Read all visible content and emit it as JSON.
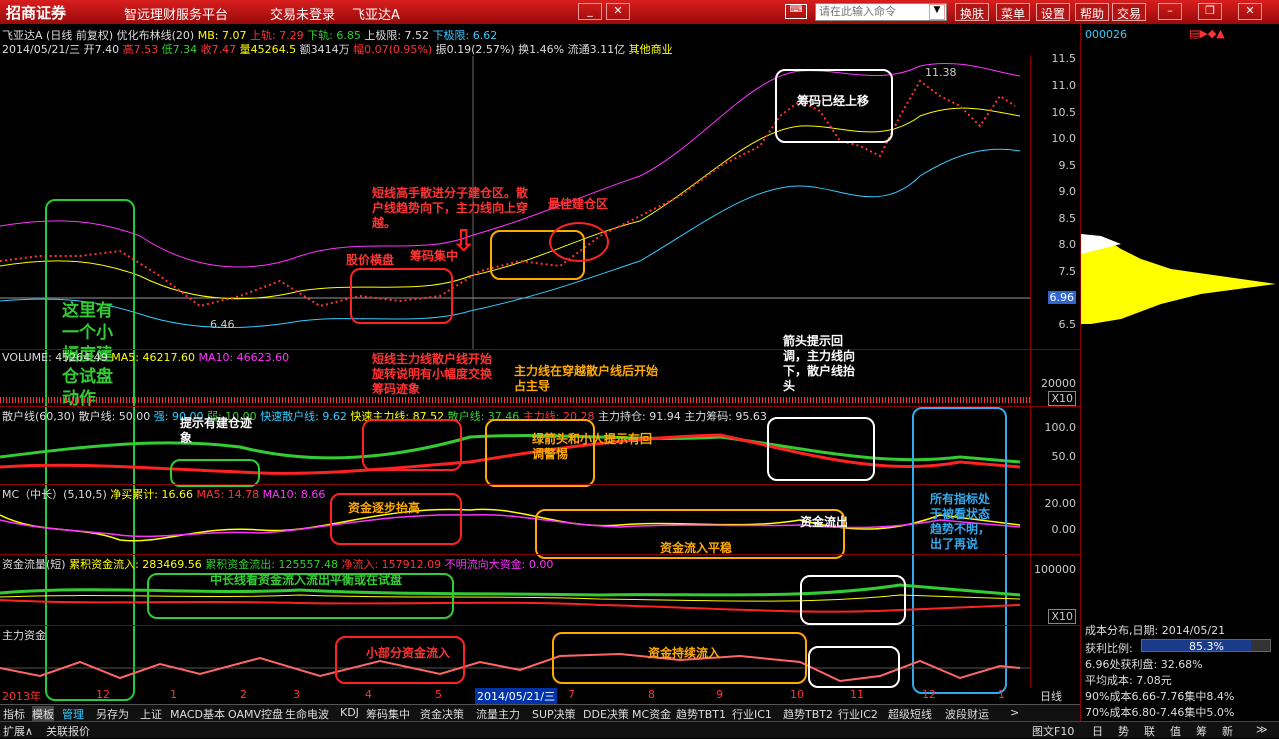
{
  "titlebar": {
    "brand": "招商证券",
    "platform": "智远理财服务平台",
    "login": "交易未登录",
    "stock": "飞亚达A",
    "command_placeholder": "请在此输入命令",
    "buttons": [
      "换肤",
      "菜单",
      "设置",
      "帮助",
      "交易"
    ]
  },
  "info1": {
    "name": "飞亚达A",
    "mode": "(日线 前复权)",
    "indicator": "优化布林线(20)",
    "mb": "MB: 7.07",
    "up": "上轨: 7.29",
    "down": "下轨: 6.85",
    "uplimit": "上极限: 7.52",
    "downlimit": "下极限: 6.62"
  },
  "info2": {
    "date": "2014/05/21/三",
    "open": "开7.40",
    "high": "高7.53",
    "low": "低7.34",
    "close": "收7.47",
    "vol": "量45264.5",
    "amt": "额3414万",
    "chg": "幅0.07(0.95%)",
    "amp": "振0.19(2.57%)",
    "turn": "换1.46%",
    "float": "流通3.11亿",
    "sector": "其他商业"
  },
  "price_axis": [
    "11.5",
    "11.0",
    "10.5",
    "10.0",
    "9.5",
    "9.0",
    "8.5",
    "8.0",
    "7.5",
    "7.0",
    "6.5"
  ],
  "price_marks": {
    "high": "11.38",
    "low": "6.46",
    "current": "6.96"
  },
  "volume": {
    "label": "VOLUME: 45264.49",
    "ma5": "MA5: 46217.60",
    "ma10": "MA10: 46623.60",
    "axis": "20000",
    "unit": "X10"
  },
  "sanhu": {
    "label": "散户线(60,30)",
    "f1": "散户线: 50.00",
    "f2": "强: 90.00",
    "f3": "弱: 10.00",
    "f4": "快速散户线: 9.62",
    "f5": "快速主力线: 87.52",
    "f6": "散户线: 37.46",
    "f7": "主力线: 20.28",
    "f8": "主力持仓: 91.94",
    "f9": "主力筹码: 95.63",
    "axis": [
      "100.0",
      "50.0"
    ]
  },
  "mc": {
    "label": "MC（中长）(5,10,5)",
    "f1": "净买累计: 16.66",
    "f2": "MA5: 14.78",
    "f3": "MA10: 8.66",
    "axis": [
      "20.00",
      "0.00"
    ]
  },
  "flow": {
    "label": "资金流量(短)",
    "f1": "累积资金流入: 283469.56",
    "f2": "累积资金流出: 125557.48",
    "f3": "净流入: 157912.09",
    "f4": "不明流向大资金: 0.00",
    "axis": "100000",
    "unit": "X10"
  },
  "main": {
    "label": "主力资金"
  },
  "annotations": {
    "a1": "这里有一个小幅度建仓试盘动作",
    "a2": "股价横盘",
    "a3": "筹码集中",
    "a4": "短线高手散进分子建仓区。散户线趋势向下，主力线向上穿越。",
    "a5": "最佳建仓区",
    "a6": "筹码已经上移",
    "a7": "短线主力线散户线开始旋转说明有小幅度交换筹码迹象",
    "a8": "主力线在穿越散户线后开始占主导",
    "a9": "箭头提示回调，主力线向下，散户线抬头",
    "a10": "提示有建仓迹象",
    "a11": "绿箭头和小人提示有回调警惕",
    "a12": "资金逐步抬高",
    "a13": "资金流入平稳",
    "a14": "资金流出",
    "a15": "所有指标处于被看状态趋势不明，出了再说",
    "a16": "中长线看资金流入流出平衡或在试盘",
    "a17": "小部分资金流入",
    "a18": "资金持续流入"
  },
  "dates": [
    "2013年",
    "12",
    "1",
    "2",
    "3",
    "4",
    "5",
    "2014/05/21/三",
    "7",
    "8",
    "9",
    "10",
    "11",
    "12",
    "1"
  ],
  "right": {
    "code": "000026",
    "dist_title": "成本分布,日期: 2014/05/21",
    "profit_label": "获利比例:",
    "profit_val": "85.3%",
    "profit_at": "6.96处获利盘: 32.68%",
    "avg_cost": "平均成本: 7.08元",
    "c90": "90%成本6.66-7.76集中8.4%",
    "c70": "70%成本6.80-7.46集中5.0%",
    "day": "日线",
    "price_axis": [
      "11.5",
      "11.0",
      "10.5",
      "10.0",
      "9.5",
      "9.0",
      "8.5",
      "8.0",
      "7.5",
      "7.0",
      "6.5"
    ]
  },
  "tabs": [
    "指标",
    "模板",
    "管理",
    "另存为",
    "上证",
    "MACD基本",
    "OAMV控盘",
    "生命电波",
    "KDJ",
    "筹码集中",
    "资金决策",
    "流量主力",
    "SUP决策",
    "DDE决策",
    "MC资金",
    "趋势TBT1",
    "行业IC1",
    "趋势TBT2",
    "行业IC2",
    "超级短线",
    "波段财运"
  ],
  "bottom": {
    "b1": "扩展∧",
    "b2": "关联报价",
    "b3": "图文F10",
    "b4": "日",
    "b5": "势",
    "b6": "联",
    "b7": "值",
    "b8": "筹",
    "b9": "新",
    "b10": "≫"
  },
  "colors": {
    "titlebar": "#c81414",
    "up": "#ff3333",
    "down": "#33ccff",
    "ma": "#ffff00"
  }
}
